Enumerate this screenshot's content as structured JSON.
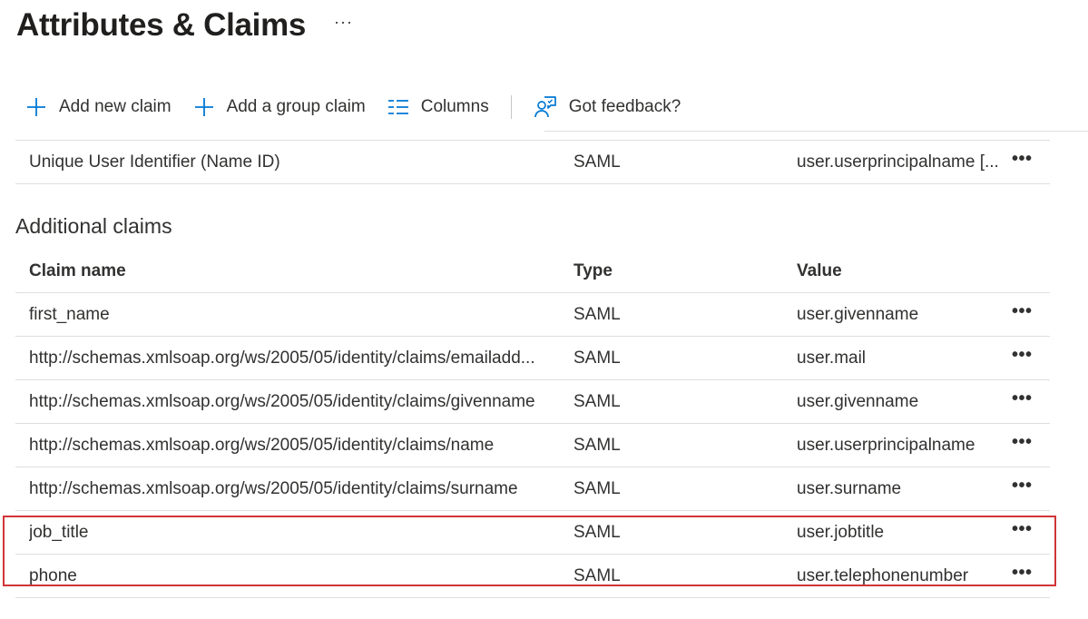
{
  "page": {
    "title": "Attributes & Claims",
    "more_label": "···"
  },
  "toolbar": {
    "add_new_claim": "Add new claim",
    "add_group_claim": "Add a group claim",
    "columns": "Columns",
    "feedback": "Got feedback?"
  },
  "required_claim": {
    "name": "Unique User Identifier (Name ID)",
    "type": "SAML",
    "value": "user.userprincipalname [..."
  },
  "additional": {
    "heading": "Additional claims",
    "columns": {
      "name": "Claim name",
      "type": "Type",
      "value": "Value"
    },
    "rows": [
      {
        "name": "first_name",
        "type": "SAML",
        "value": "user.givenname"
      },
      {
        "name": "http://schemas.xmlsoap.org/ws/2005/05/identity/claims/emailadd...",
        "type": "SAML",
        "value": "user.mail"
      },
      {
        "name": "http://schemas.xmlsoap.org/ws/2005/05/identity/claims/givenname",
        "type": "SAML",
        "value": "user.givenname"
      },
      {
        "name": "http://schemas.xmlsoap.org/ws/2005/05/identity/claims/name",
        "type": "SAML",
        "value": "user.userprincipalname"
      },
      {
        "name": "http://schemas.xmlsoap.org/ws/2005/05/identity/claims/surname",
        "type": "SAML",
        "value": "user.surname"
      },
      {
        "name": "job_title",
        "type": "SAML",
        "value": "user.jobtitle"
      },
      {
        "name": "phone",
        "type": "SAML",
        "value": "user.telephonenumber"
      }
    ]
  },
  "row_more_label": "•••",
  "colors": {
    "accent": "#0078d4",
    "highlight": "#d13438",
    "divider": "#e1dfdd"
  },
  "icons": {
    "add": "plus-icon",
    "columns": "columns-icon",
    "feedback": "feedback-icon"
  }
}
